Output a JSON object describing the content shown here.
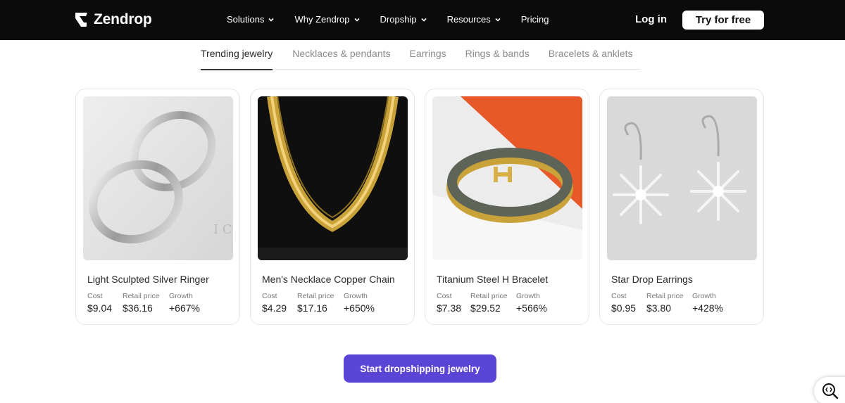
{
  "brand": {
    "name": "Zendrop"
  },
  "nav": {
    "items": [
      {
        "label": "Solutions",
        "dropdown": true
      },
      {
        "label": "Why Zendrop",
        "dropdown": true
      },
      {
        "label": "Dropship",
        "dropdown": true
      },
      {
        "label": "Resources",
        "dropdown": true
      },
      {
        "label": "Pricing",
        "dropdown": false
      }
    ],
    "login_label": "Log in",
    "cta_label": "Try for free"
  },
  "tabs": [
    {
      "label": "Trending jewelry",
      "active": true
    },
    {
      "label": "Necklaces & pendants",
      "active": false
    },
    {
      "label": "Earrings",
      "active": false
    },
    {
      "label": "Rings & bands",
      "active": false
    },
    {
      "label": "Bracelets & anklets",
      "active": false
    }
  ],
  "stat_labels": {
    "cost": "Cost",
    "retail": "Retail price",
    "growth": "Growth"
  },
  "products": [
    {
      "title": "Light Sculpted Silver Ringer",
      "cost": "$9.04",
      "retail": "$36.16",
      "growth": "+667%"
    },
    {
      "title": "Men's Necklace Copper Chain",
      "cost": "$4.29",
      "retail": "$17.16",
      "growth": "+650%"
    },
    {
      "title": "Titanium Steel H Bracelet",
      "cost": "$7.38",
      "retail": "$29.52",
      "growth": "+566%"
    },
    {
      "title": "Star Drop Earrings",
      "cost": "$0.95",
      "retail": "$3.80",
      "growth": "+428%"
    }
  ],
  "cta": {
    "label": "Start dropshipping jewelry"
  },
  "colors": {
    "header_bg": "#0b0b0b",
    "accent": "#5b45d6",
    "tab_active": "#2a2a2a",
    "tab_inactive": "#8a8a8a"
  },
  "icons": {
    "logo": "zendrop-logo-icon",
    "chevron": "chevron-down-icon",
    "widget": "search-code-icon"
  }
}
